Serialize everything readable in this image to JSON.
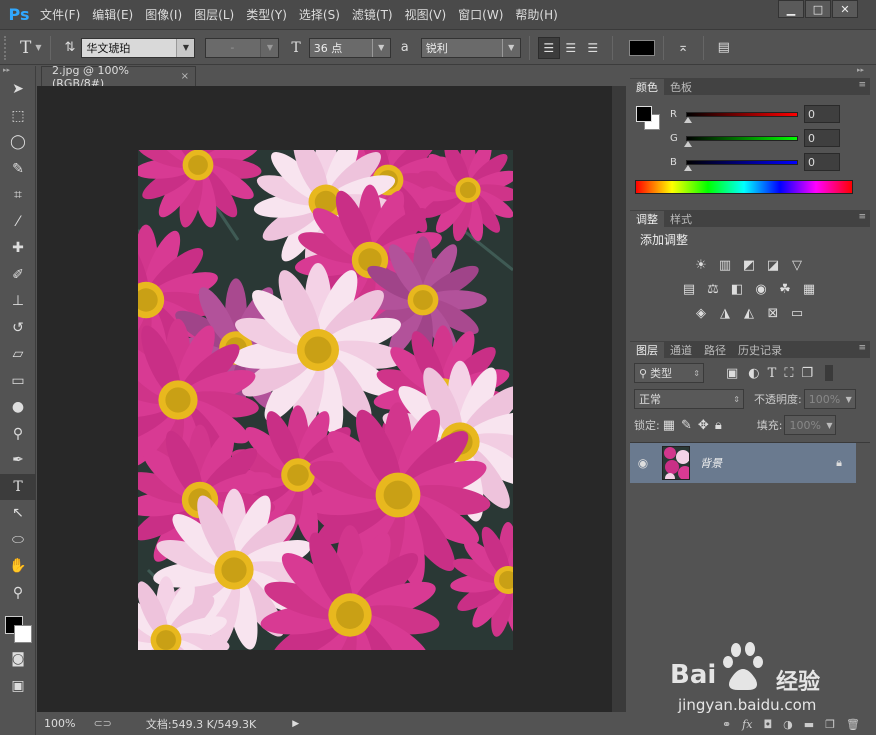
{
  "menubar": {
    "logo": "Ps",
    "items": [
      "文件(F)",
      "编辑(E)",
      "图像(I)",
      "图层(L)",
      "类型(Y)",
      "选择(S)",
      "滤镜(T)",
      "视图(V)",
      "窗口(W)",
      "帮助(H)"
    ],
    "window_buttons": [
      "▁",
      "□",
      "✕"
    ]
  },
  "options": {
    "tool_glyph": "T",
    "font_family": "华文琥珀",
    "font_style": "-",
    "size_glyph": "T",
    "font_size": "36 点",
    "aa_glyph": "a",
    "antialias": "锐利",
    "text_color": "#000000"
  },
  "document": {
    "tab_title": "2.jpg @ 100%(RGB/8#)",
    "tab_close": "×",
    "zoom": "100%",
    "doc_info": "文档:549.3 K/549.3K",
    "status_arrow": "▶"
  },
  "color_panel": {
    "tabs": [
      "颜色",
      "色板"
    ],
    "channels": [
      {
        "label": "R",
        "value": "0",
        "color": "#ff0000"
      },
      {
        "label": "G",
        "value": "0",
        "color": "#00ff00"
      },
      {
        "label": "B",
        "value": "0",
        "color": "#0000ff"
      }
    ]
  },
  "adjust_panel": {
    "tabs": [
      "调整",
      "样式"
    ],
    "heading": "添加调整"
  },
  "layers_panel": {
    "tabs": [
      "图层",
      "通道",
      "路径",
      "历史记录"
    ],
    "filter_kind": "类型",
    "blend_mode": "正常",
    "opacity_label": "不透明度:",
    "opacity_value": "100%",
    "lock_label": "锁定:",
    "fill_label": "填充:",
    "fill_value": "100%",
    "layers": [
      {
        "name": "背景",
        "visible": true,
        "locked": true
      }
    ]
  },
  "watermark": {
    "brand": "Bai",
    "brand2": "经验",
    "url": "jingyan.baidu.com"
  },
  "colors": {
    "panel_bg": "#535353",
    "canvas_bg": "#282828",
    "selected_layer": "#6a7a8f",
    "accent": "#31a8ff"
  }
}
